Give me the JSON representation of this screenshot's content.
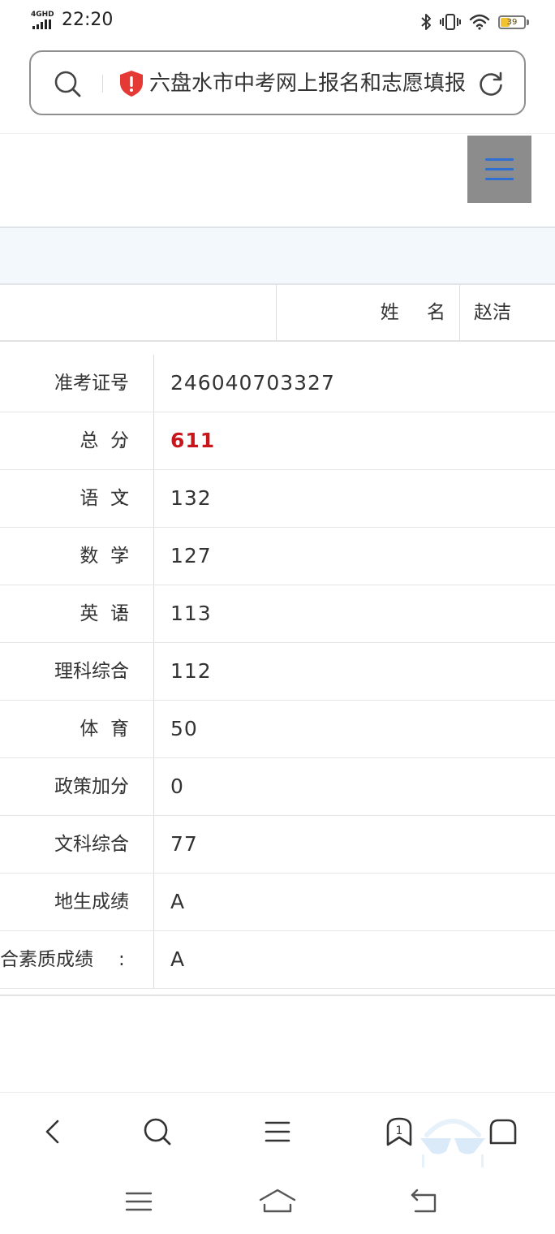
{
  "status_bar": {
    "network": "4GHD",
    "time": "22:20",
    "battery_level": "39"
  },
  "address_bar": {
    "page_title": "六盘水市中考网上报名和志愿填报"
  },
  "header": {
    "name_label": "姓    名",
    "name_value": "赵洁"
  },
  "scores": [
    {
      "label": "准考证号",
      "colon": ":",
      "value": "246040703327"
    },
    {
      "label": "总  分",
      "colon": ":",
      "value": "611"
    },
    {
      "label": "语  文",
      "colon": ":",
      "value": "132"
    },
    {
      "label": "数  学",
      "colon": ":",
      "value": "127"
    },
    {
      "label": "英  语",
      "colon": ":",
      "value": "113"
    },
    {
      "label": "理科综合",
      "colon": ":",
      "value": "112"
    },
    {
      "label": "体  育",
      "colon": ":",
      "value": "50"
    },
    {
      "label": "政策加分",
      "colon": ":",
      "value": "0"
    },
    {
      "label": "文科综合",
      "colon": ":",
      "value": "77"
    },
    {
      "label": "地生成绩",
      "colon": ":",
      "value": "A"
    },
    {
      "label": "合素质成绩",
      "colon": ":",
      "value": "A"
    }
  ],
  "bottom_toolbar": {
    "tab_count": "1"
  },
  "colors": {
    "accent_blue": "#2e6fcf",
    "total_red": "#c8161d",
    "band_blue": "#f3f8fd",
    "shield_red": "#e53935",
    "battery_yellow": "#f2c233"
  },
  "icons": [
    "search-icon",
    "shield-icon",
    "reload-icon",
    "hamburger-menu-icon",
    "back-icon",
    "menu-icon",
    "tabs-icon",
    "home-icon",
    "recent-apps-icon",
    "system-home-icon",
    "system-back-icon"
  ]
}
